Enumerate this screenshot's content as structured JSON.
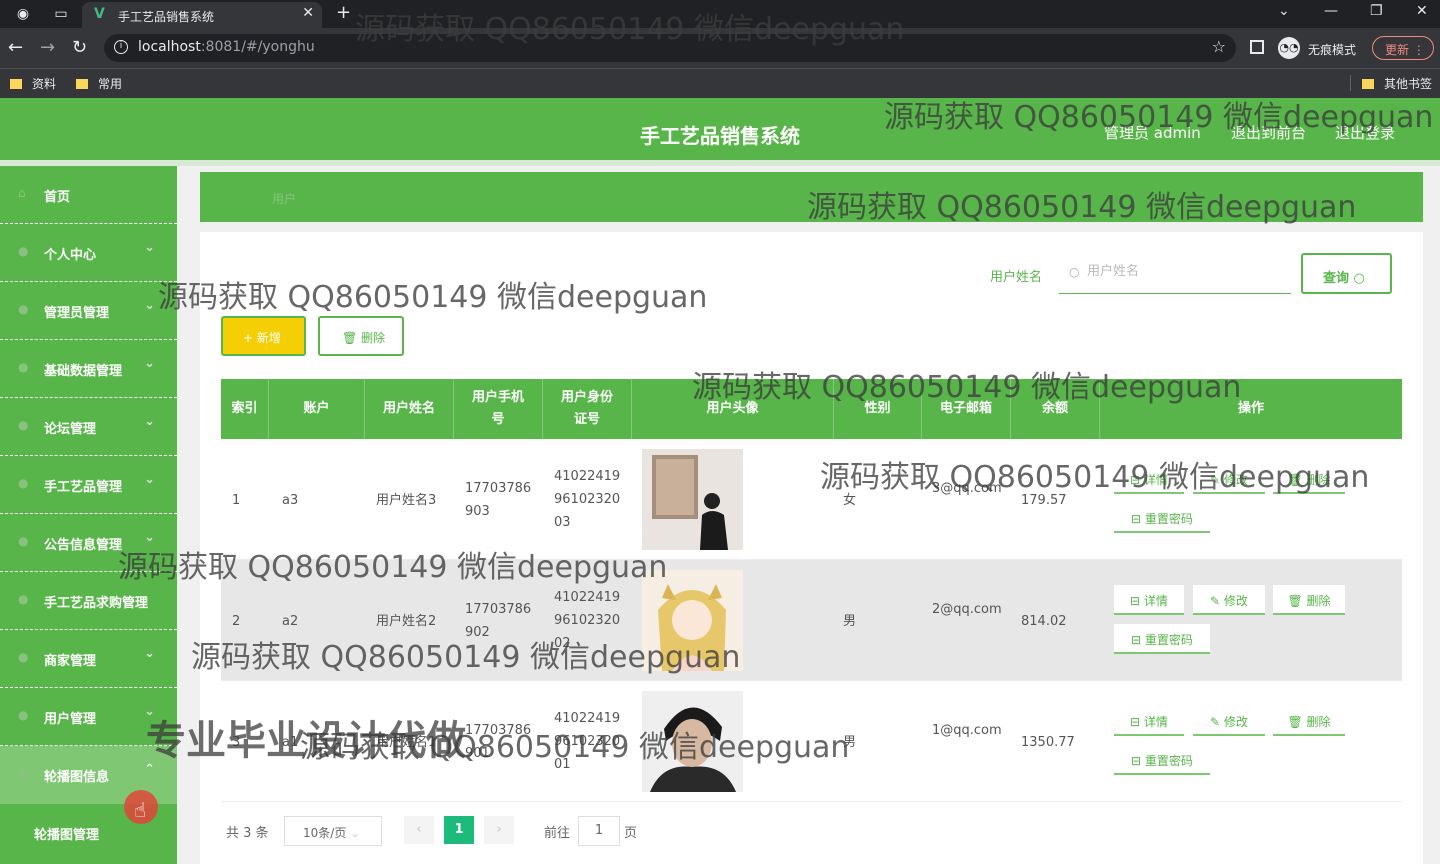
{
  "browser": {
    "tab_title": "手工艺品销售系统",
    "url_host": "localhost",
    "url_path": ":8081/#/yonghu",
    "incognito_label": "无痕模式",
    "update_label": "更新",
    "bookmarks": [
      "资料",
      "常用"
    ],
    "other_bookmarks": "其他书签"
  },
  "header": {
    "title": "手工艺品销售系统",
    "user": "管理员 admin",
    "front_link": "退出到前台",
    "logout_link": "退出登录"
  },
  "sidebar": {
    "items": [
      {
        "label": "首页",
        "chevron": ""
      },
      {
        "label": "个人中心",
        "chevron": "⌄"
      },
      {
        "label": "管理员管理",
        "chevron": "⌄"
      },
      {
        "label": "基础数据管理",
        "chevron": "⌄"
      },
      {
        "label": "论坛管理",
        "chevron": "⌄"
      },
      {
        "label": "手工艺品管理",
        "chevron": "⌄"
      },
      {
        "label": "公告信息管理",
        "chevron": "⌄"
      },
      {
        "label": "手工艺品求购管理",
        "chevron": ""
      },
      {
        "label": "商家管理",
        "chevron": "⌄"
      },
      {
        "label": "用户管理",
        "chevron": "⌄"
      },
      {
        "label": "轮播图信息",
        "chevron": "⌃"
      }
    ],
    "submenu": "轮播图管理"
  },
  "breadcrumb": "用户",
  "search": {
    "label": "用户姓名",
    "placeholder": "用户姓名",
    "button": "查询"
  },
  "toolbar": {
    "add": "新增",
    "delete": "删除"
  },
  "table": {
    "headers": [
      "索引",
      "账户",
      "用户姓名",
      "用户手机号",
      "用户身份证号",
      "用户头像",
      "性别",
      "电子邮箱",
      "余额",
      "操作"
    ],
    "rows": [
      {
        "index": "1",
        "account": "a3",
        "name": "用户姓名3",
        "phone": "17703786903",
        "id_card": "410224199610232003",
        "gender": "女",
        "email": "3@qq.com",
        "balance": "179.57"
      },
      {
        "index": "2",
        "account": "a2",
        "name": "用户姓名2",
        "phone": "17703786902",
        "id_card": "410224199610232002",
        "gender": "男",
        "email": "2@qq.com",
        "balance": "814.02"
      },
      {
        "index": "3",
        "account": "a1",
        "name": "用户姓名1",
        "phone": "17703786901",
        "id_card": "410224199610232001",
        "gender": "男",
        "email": "1@qq.com",
        "balance": "1350.77"
      }
    ],
    "actions": {
      "detail": "详情",
      "edit": "修改",
      "delete": "删除",
      "reset": "重置密码"
    }
  },
  "pager": {
    "total": "共 3 条",
    "page_size": "10条/页",
    "current": "1",
    "goto": "前往",
    "goto_value": "1",
    "unit": "页"
  },
  "watermarks": {
    "text": "源码获取 QQ86050149 微信deepguan",
    "banner": "专业毕业设计代做"
  },
  "colors": {
    "primary": "#58b549",
    "add_button": "#f4cf05",
    "page_active": "#1cbb7c"
  }
}
